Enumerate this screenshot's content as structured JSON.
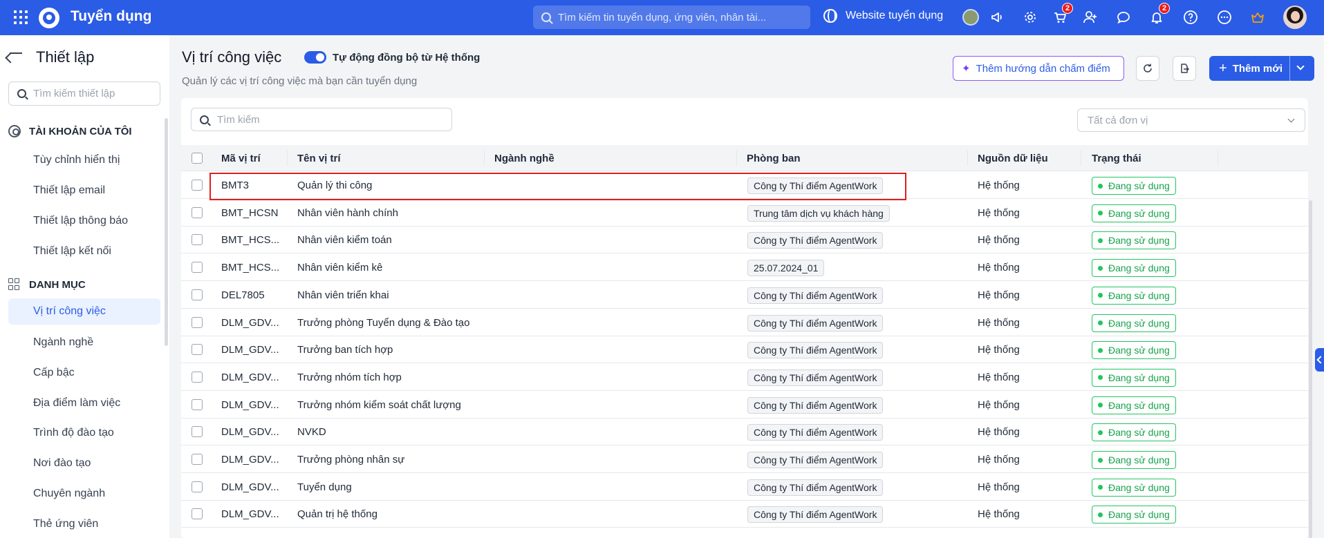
{
  "topbar": {
    "app_title": "Tuyển dụng",
    "search_placeholder": "Tìm kiếm tin tuyển dụng, ứng viên, nhân tài...",
    "website_link": "Website tuyển dụng",
    "cart_badge": "2",
    "notification_badge": "2",
    "accent_color": "#2b5ce6"
  },
  "sidebar": {
    "title": "Thiết lập",
    "search_placeholder": "Tìm kiếm thiết lập",
    "sections": [
      {
        "label": "TÀI KHOẢN CỦA TÔI",
        "icon": "user-circle-icon"
      },
      {
        "label": "DANH MỤC",
        "icon": "grid-icon"
      }
    ],
    "account_items": [
      "Tùy chỉnh hiển thị",
      "Thiết lập email",
      "Thiết lập thông báo",
      "Thiết lập kết nối"
    ],
    "category_items": [
      "Vị trí công việc",
      "Ngành nghề",
      "Cấp bậc",
      "Địa điểm làm việc",
      "Trình độ đào tạo",
      "Nơi đào tạo",
      "Chuyên ngành",
      "Thẻ ứng viên"
    ],
    "active_item": "Vị trí công việc"
  },
  "main": {
    "title": "Vị trí công việc",
    "toggle_label": "Tự động đồng bộ từ Hệ thống",
    "toggle_on": true,
    "subtitle": "Quản lý các vị trí công việc mà bạn cần tuyển dụng",
    "guide_button": "Thêm hướng dẫn chấm điểm",
    "add_button": "Thêm mới",
    "table_search_placeholder": "Tìm kiếm",
    "unit_select_placeholder": "Tất cả đơn vị"
  },
  "table": {
    "columns": [
      "Mã vị trí",
      "Tên vị trí",
      "Ngành nghề",
      "Phòng ban",
      "Nguồn dữ liệu",
      "Trạng thái"
    ],
    "rows": [
      {
        "code": "BMT3",
        "name": "Quản lý thi công",
        "industry": "",
        "dept": "Công ty Thí điểm AgentWork",
        "source": "Hệ thống",
        "status": "Đang sử dụng"
      },
      {
        "code": "BMT_HCSN",
        "name": "Nhân viên hành chính",
        "industry": "",
        "dept": "Trung tâm dịch vụ khách hàng",
        "source": "Hệ thống",
        "status": "Đang sử dụng"
      },
      {
        "code": "BMT_HCS...",
        "name": "Nhân viên kiểm toán",
        "industry": "",
        "dept": "Công ty Thí điểm AgentWork",
        "source": "Hệ thống",
        "status": "Đang sử dụng"
      },
      {
        "code": "BMT_HCS...",
        "name": "Nhân viên kiểm kê",
        "industry": "",
        "dept": "25.07.2024_01",
        "source": "Hệ thống",
        "status": "Đang sử dụng"
      },
      {
        "code": "DEL7805",
        "name": "Nhân viên triển khai",
        "industry": "",
        "dept": "Công ty Thí điểm AgentWork",
        "source": "Hệ thống",
        "status": "Đang sử dụng"
      },
      {
        "code": "DLM_GDV...",
        "name": "Trưởng phòng Tuyển dụng & Đào tạo",
        "industry": "",
        "dept": "Công ty Thí điểm AgentWork",
        "source": "Hệ thống",
        "status": "Đang sử dụng"
      },
      {
        "code": "DLM_GDV...",
        "name": "Trưởng ban tích hợp",
        "industry": "",
        "dept": "Công ty Thí điểm AgentWork",
        "source": "Hệ thống",
        "status": "Đang sử dụng"
      },
      {
        "code": "DLM_GDV...",
        "name": "Trưởng nhóm tích hợp",
        "industry": "",
        "dept": "Công ty Thí điểm AgentWork",
        "source": "Hệ thống",
        "status": "Đang sử dụng"
      },
      {
        "code": "DLM_GDV...",
        "name": "Trưởng nhóm kiểm soát chất lượng",
        "industry": "",
        "dept": "Công ty Thí điểm AgentWork",
        "source": "Hệ thống",
        "status": "Đang sử dụng"
      },
      {
        "code": "DLM_GDV...",
        "name": "NVKD",
        "industry": "",
        "dept": "Công ty Thí điểm AgentWork",
        "source": "Hệ thống",
        "status": "Đang sử dụng"
      },
      {
        "code": "DLM_GDV...",
        "name": "Trưởng phòng nhân sự",
        "industry": "",
        "dept": "Công ty Thí điểm AgentWork",
        "source": "Hệ thống",
        "status": "Đang sử dụng"
      },
      {
        "code": "DLM_GDV...",
        "name": "Tuyển dụng",
        "industry": "",
        "dept": "Công ty Thí điểm AgentWork",
        "source": "Hệ thống",
        "status": "Đang sử dụng"
      },
      {
        "code": "DLM_GDV...",
        "name": "Quản trị hệ thống",
        "industry": "",
        "dept": "Công ty Thí điểm AgentWork",
        "source": "Hệ thống",
        "status": "Đang sử dụng"
      }
    ],
    "status_color": "#22c55e",
    "highlight_color": "#e11d1d"
  }
}
